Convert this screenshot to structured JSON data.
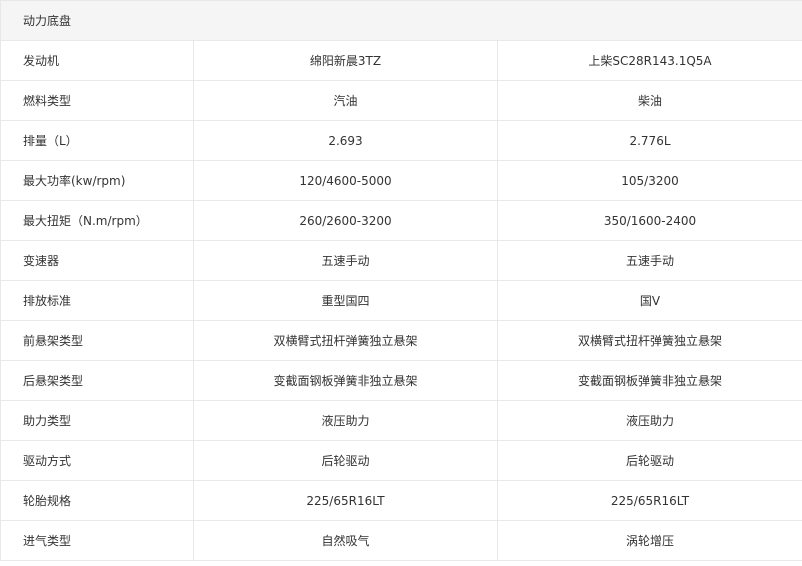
{
  "section": {
    "title": "动力底盘"
  },
  "rows": [
    {
      "label": "发动机",
      "a": "绵阳新晨3TZ",
      "b": "上柴SC28R143.1Q5A"
    },
    {
      "label": "燃料类型",
      "a": "汽油",
      "b": "柴油"
    },
    {
      "label": "排量（L）",
      "a": "2.693",
      "b": "2.776L"
    },
    {
      "label": "最大功率(kw/rpm)",
      "a": "120/4600-5000",
      "b": "105/3200"
    },
    {
      "label": "最大扭矩（N.m/rpm）",
      "a": "260/2600-3200",
      "b": "350/1600-2400"
    },
    {
      "label": "变速器",
      "a": "五速手动",
      "b": "五速手动"
    },
    {
      "label": "排放标准",
      "a": "重型国四",
      "b": "国V"
    },
    {
      "label": "前悬架类型",
      "a": "双横臂式扭杆弹簧独立悬架",
      "b": "双横臂式扭杆弹簧独立悬架"
    },
    {
      "label": "后悬架类型",
      "a": "变截面钢板弹簧非独立悬架",
      "b": "变截面钢板弹簧非独立悬架"
    },
    {
      "label": "助力类型",
      "a": "液压助力",
      "b": "液压助力"
    },
    {
      "label": "驱动方式",
      "a": "后轮驱动",
      "b": "后轮驱动"
    },
    {
      "label": "轮胎规格",
      "a": "225/65R16LT",
      "b": "225/65R16LT"
    },
    {
      "label": "进气类型",
      "a": "自然吸气",
      "b": "涡轮增压"
    }
  ]
}
